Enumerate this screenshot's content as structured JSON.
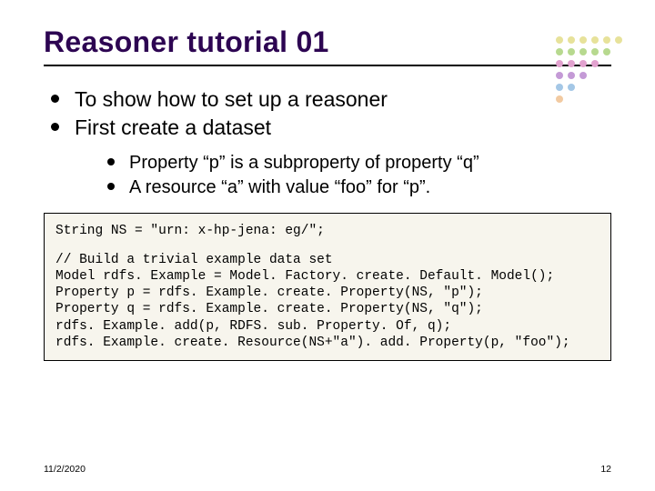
{
  "title": "Reasoner tutorial 01",
  "bullets": {
    "b1": "To show how to set up a reasoner",
    "b2": "First create a dataset",
    "sub1": "Property “p” is a subproperty of property “q”",
    "sub2": "A resource “a” with value “foo” for “p”."
  },
  "code": {
    "l1": "String NS = \"urn: x-hp-jena: eg/\";",
    "l2": "// Build a trivial example data set",
    "l3": "Model rdfs. Example = Model. Factory. create. Default. Model();",
    "l4": "Property p = rdfs. Example. create. Property(NS, \"p\");",
    "l5": "Property q = rdfs. Example. create. Property(NS, \"q\");",
    "l6": "rdfs. Example. add(p, RDFS. sub. Property. Of, q);",
    "l7": "rdfs. Example. create. Resource(NS+\"a\"). add. Property(p, \"foo\");"
  },
  "footer": {
    "date": "11/2/2020",
    "page": "12"
  },
  "dot_colors": [
    "#e7e29a",
    "#e7e29a",
    "#e7e29a",
    "#e7e29a",
    "#e7e29a",
    "#e7e29a",
    "#b7d98f",
    "#b7d98f",
    "#b7d98f",
    "#b7d98f",
    "#b7d98f",
    "transparent",
    "#e2a2cf",
    "#e2a2cf",
    "#e2a2cf",
    "#e2a2cf",
    "transparent",
    "transparent",
    "#c49ad6",
    "#c49ad6",
    "#c49ad6",
    "transparent",
    "transparent",
    "transparent",
    "#a4c7e6",
    "#a4c7e6",
    "transparent",
    "transparent",
    "transparent",
    "transparent",
    "#f2caa1",
    "transparent",
    "transparent",
    "transparent",
    "transparent",
    "transparent"
  ]
}
